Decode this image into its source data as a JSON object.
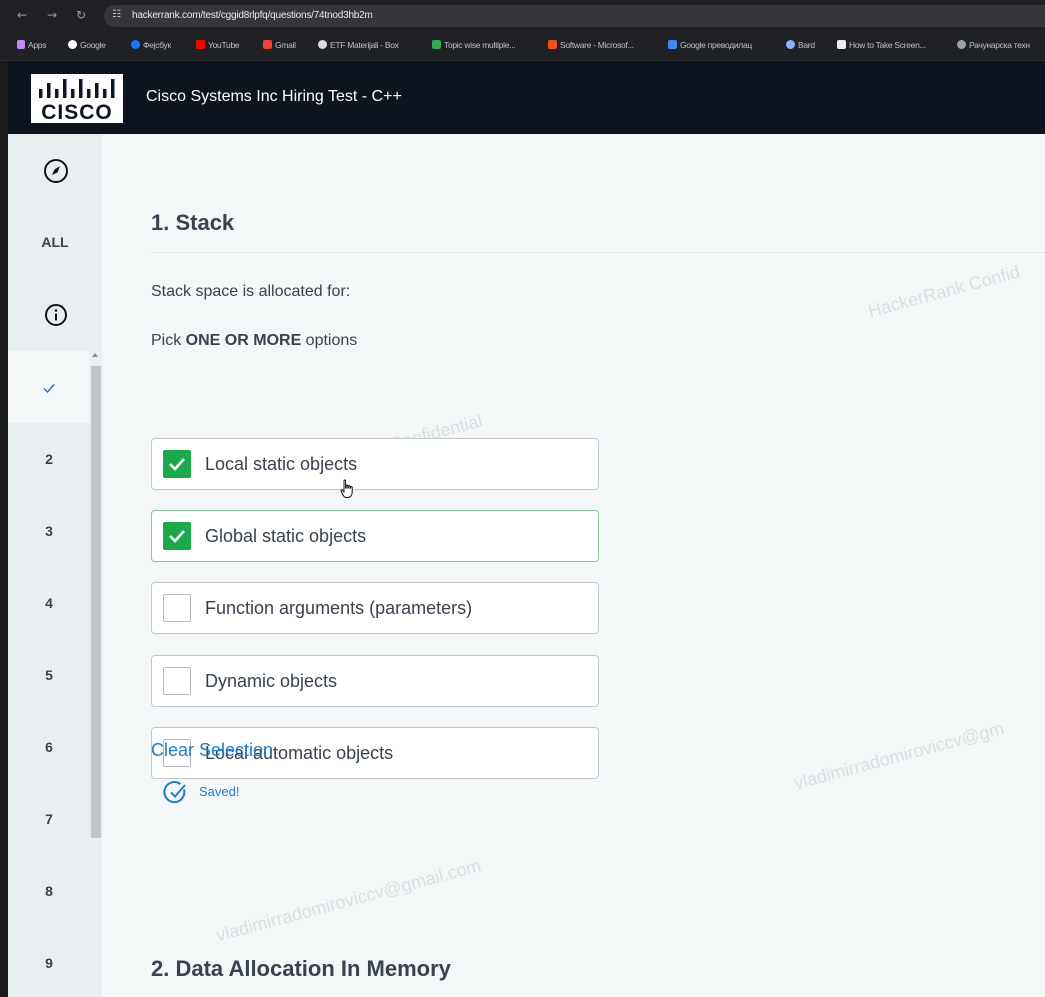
{
  "browser": {
    "url": "hackerrank.com/test/cggid8rlpfq/questions/74tnod3hb2m",
    "bookmarks": [
      "Apps",
      "Google",
      "Фејсбук",
      "YouTube",
      "Gmail",
      "ETF Materijali - Box",
      "Topic wise multiple...",
      "Software - Microsof...",
      "Google преводилац",
      "Bard",
      "How to Take Screen...",
      "Рачунарска техн"
    ]
  },
  "header": {
    "logo_text": "CISCO",
    "test_title": "Cisco Systems Inc Hiring Test - C++"
  },
  "sidebar": {
    "all_label": "ALL",
    "active_item_icon": "check-icon",
    "items": [
      "2",
      "3",
      "4",
      "5",
      "6",
      "7",
      "8",
      "9"
    ]
  },
  "question1": {
    "title": "1. Stack",
    "text": "Stack space is allocated for:",
    "instruction_prefix": "Pick ",
    "instruction_bold": "ONE OR MORE",
    "instruction_suffix": " options",
    "options": [
      {
        "label": "Local static objects",
        "checked": true
      },
      {
        "label": "Global static objects",
        "checked": true
      },
      {
        "label": "Function arguments (parameters)",
        "checked": false
      },
      {
        "label": "Dynamic objects",
        "checked": false
      },
      {
        "label": "Local automatic objects",
        "checked": false
      }
    ],
    "clear_label": "Clear Selection",
    "saved_label": "Saved!"
  },
  "question2": {
    "title": "2. Data Allocation In Memory"
  },
  "watermarks": [
    "HackerRank Confid",
    "HackerRank Confidential",
    "vladimirradomiroviccv@gm",
    "vladimirradomiroviccv@gmail.com"
  ],
  "colors": {
    "header_bg": "#0e141e",
    "checkbox_checked": "#1ba94c",
    "link": "#1f7cc6",
    "active_indicator": "#1b6ec2"
  }
}
